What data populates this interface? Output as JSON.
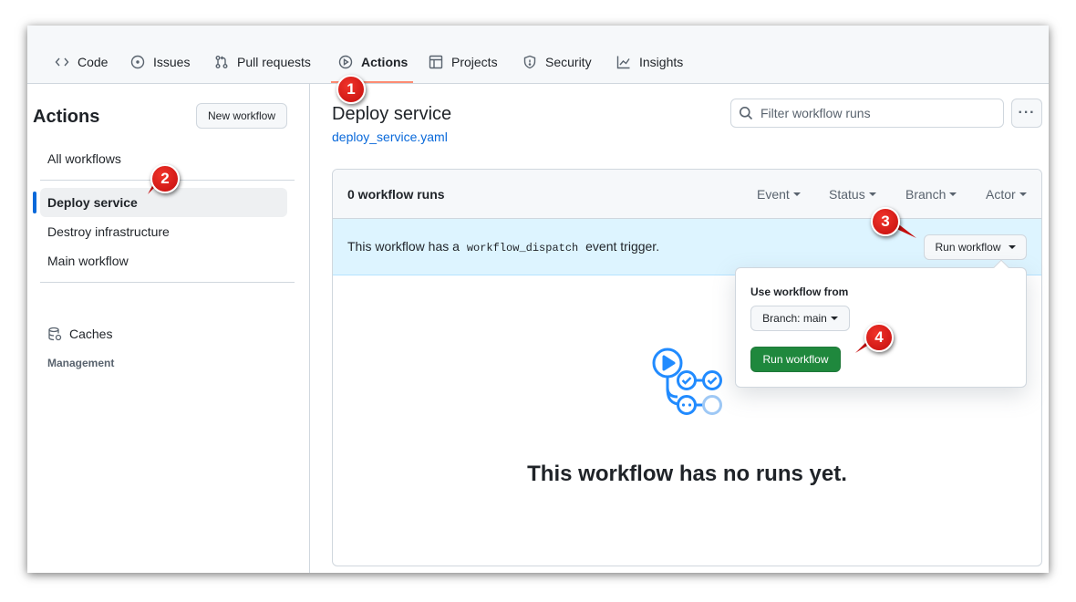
{
  "nav": {
    "tabs": [
      {
        "label": "Code",
        "icon": "code-icon"
      },
      {
        "label": "Issues",
        "icon": "issue-icon"
      },
      {
        "label": "Pull requests",
        "icon": "pull-request-icon"
      },
      {
        "label": "Actions",
        "icon": "play-icon",
        "active": true
      },
      {
        "label": "Projects",
        "icon": "table-icon"
      },
      {
        "label": "Security",
        "icon": "shield-icon"
      },
      {
        "label": "Insights",
        "icon": "graph-icon"
      }
    ]
  },
  "sidebar": {
    "title": "Actions",
    "new_workflow_label": "New workflow",
    "all_workflows_label": "All workflows",
    "workflows": [
      {
        "label": "Deploy service",
        "selected": true
      },
      {
        "label": "Destroy infrastructure"
      },
      {
        "label": "Main workflow"
      }
    ],
    "management_heading": "Management",
    "caches_label": "Caches"
  },
  "main": {
    "workflow_title": "Deploy service",
    "workflow_file": "deploy_service.yaml",
    "filter_placeholder": "Filter workflow runs",
    "more_label": "···",
    "runs_count": "0 workflow runs",
    "filters": {
      "event": "Event",
      "status": "Status",
      "branch": "Branch",
      "actor": "Actor"
    },
    "dispatch": {
      "prefix": "This workflow has a",
      "code": "workflow_dispatch",
      "suffix": "event trigger.",
      "run_button": "Run workflow"
    },
    "empty_title": "This workflow has no runs yet."
  },
  "popover": {
    "label": "Use workflow from",
    "branch_label": "Branch: main",
    "run_button": "Run workflow"
  },
  "callouts": [
    "1",
    "2",
    "3",
    "4"
  ],
  "colors": {
    "accent_blue": "#0969da",
    "green_button": "#1f883d",
    "tab_underline": "#fd8c73",
    "banner_bg": "#ddf4ff",
    "callout_red": "#d81b1b"
  }
}
